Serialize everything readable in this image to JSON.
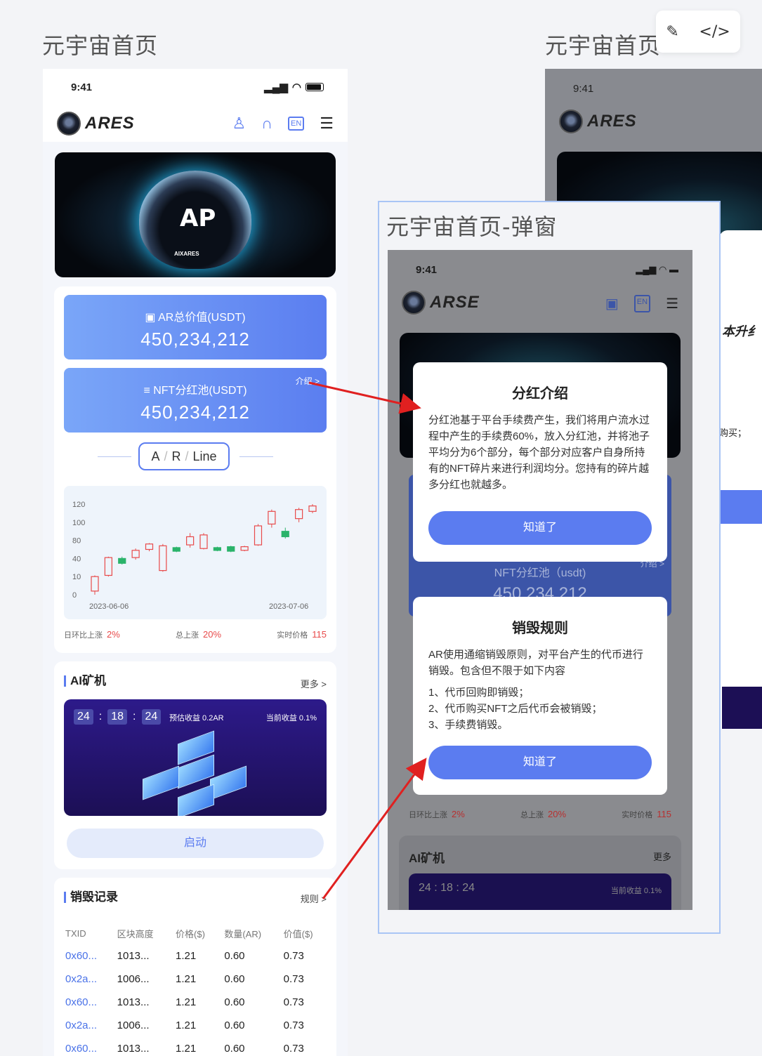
{
  "frames": {
    "home_title": "元宇宙首页",
    "home2_title": "元宇宙首页",
    "popup_title": "元宇宙首页-弹窗"
  },
  "toolbar": {
    "edit_icon": "pen-icon",
    "code_icon": "code-icon"
  },
  "status": {
    "time": "9:41"
  },
  "nav": {
    "logo": "ARES",
    "lang": "EN"
  },
  "banner": {
    "logo_text": "AP",
    "sub": "AIXARES"
  },
  "ar_total": {
    "label": "AR总价值(USDT)",
    "value": "450,234,212"
  },
  "nft_pool": {
    "label": "NFT分红池(USDT)",
    "value": "450,234,212",
    "intro": "介绍 >"
  },
  "line_tag": {
    "a": "A",
    "r": "R",
    "line": "Line"
  },
  "stats": {
    "day_label": "日环比上涨",
    "day_value": "2%",
    "total_label": "总上涨",
    "total_value": "20%",
    "price_label": "实时价格",
    "price_value": "115"
  },
  "chart_data": {
    "type": "candlestick",
    "y_ticks": [
      "120",
      "100",
      "80",
      "40",
      "10",
      "0"
    ],
    "x_start": "2023-06-06",
    "x_end": "2023-07-06",
    "candles": [
      {
        "open": 2,
        "close": 10,
        "low": 0,
        "high": 12,
        "dir": "up"
      },
      {
        "open": 12,
        "close": 42,
        "low": 10,
        "high": 44,
        "dir": "up"
      },
      {
        "open": 40,
        "close": 32,
        "low": 30,
        "high": 44,
        "dir": "down"
      },
      {
        "open": 42,
        "close": 58,
        "low": 38,
        "high": 62,
        "dir": "up"
      },
      {
        "open": 60,
        "close": 72,
        "low": 56,
        "high": 74,
        "dir": "up"
      },
      {
        "open": 20,
        "close": 68,
        "low": 18,
        "high": 72,
        "dir": "up"
      },
      {
        "open": 64,
        "close": 56,
        "low": 54,
        "high": 66,
        "dir": "down"
      },
      {
        "open": 70,
        "close": 84,
        "low": 64,
        "high": 88,
        "dir": "up"
      },
      {
        "open": 62,
        "close": 86,
        "low": 60,
        "high": 88,
        "dir": "up"
      },
      {
        "open": 64,
        "close": 58,
        "low": 56,
        "high": 66,
        "dir": "down"
      },
      {
        "open": 66,
        "close": 56,
        "low": 54,
        "high": 68,
        "dir": "down"
      },
      {
        "open": 58,
        "close": 66,
        "low": 56,
        "high": 68,
        "dir": "up"
      },
      {
        "open": 70,
        "close": 96,
        "low": 68,
        "high": 98,
        "dir": "up"
      },
      {
        "open": 98,
        "close": 112,
        "low": 94,
        "high": 114,
        "dir": "up"
      },
      {
        "open": 90,
        "close": 84,
        "low": 82,
        "high": 94,
        "dir": "down"
      },
      {
        "open": 104,
        "close": 114,
        "low": 100,
        "high": 116,
        "dir": "up"
      },
      {
        "open": 112,
        "close": 118,
        "low": 110,
        "high": 124,
        "dir": "up"
      }
    ]
  },
  "ai": {
    "title": "AI矿机",
    "more": "更多 >",
    "h": "24",
    "m": "18",
    "s": "24",
    "est": "预估收益 0.2AR",
    "cur": "当前收益 0.1%",
    "start": "启动"
  },
  "burn": {
    "title": "销毁记录",
    "rule": "规则 >",
    "headers": [
      "TXID",
      "区块高度",
      "价格($)",
      "数量(AR)",
      "价值($)"
    ],
    "rows": [
      [
        "0x60...",
        "1013...",
        "1.21",
        "0.60",
        "0.73"
      ],
      [
        "0x2a...",
        "1006...",
        "1.21",
        "0.60",
        "0.73"
      ],
      [
        "0x60...",
        "1013...",
        "1.21",
        "0.60",
        "0.73"
      ],
      [
        "0x2a...",
        "1006...",
        "1.21",
        "0.60",
        "0.73"
      ],
      [
        "0x60...",
        "1013...",
        "1.21",
        "0.60",
        "0.73"
      ]
    ]
  },
  "popup": {
    "logo": "ARSE",
    "lang": "EN",
    "dialog1_title": "分红介绍",
    "dialog1_text": "分红池基于平台手续费产生，我们将用户流水过程中产生的手续费60%，放入分红池，并将池子平均分为6个部分，每个部分对应客户自身所持有的NFT碎片来进行利润均分。您持有的碎片越多分红也就越多。",
    "dialog1_btn": "知道了",
    "behind_label": "NFT分红池（usdt)",
    "behind_value": "450,234,212",
    "behind_intro": "介绍 >",
    "dialog2_title": "销毁规则",
    "dialog2_text": "AR使用通缩销毁原则，对平台产生的代币进行销毁。包含但不限于如下内容",
    "dialog2_items": [
      "1、代币回购即销毁；",
      "2、代币购买NFT之后代币会被销毁；",
      "3、手续费销毁。"
    ],
    "dialog2_btn": "知道了",
    "ai_title": "AI矿机",
    "ai_more": "更多"
  },
  "frame2": {
    "partial_title": "本升纟",
    "partial_text": "购买；"
  }
}
